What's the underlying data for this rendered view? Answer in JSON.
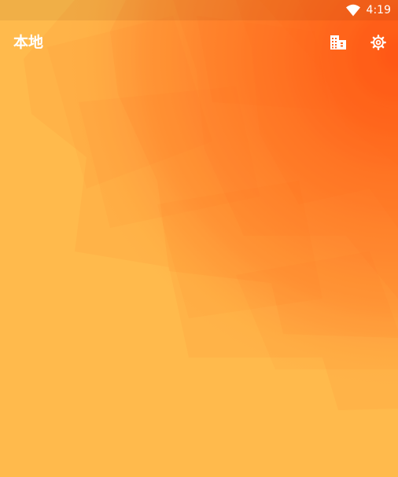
{
  "status_bar": {
    "time": "4:19",
    "wifi_icon": "wifi-icon"
  },
  "app_bar": {
    "title": "本地",
    "actions": [
      {
        "icon": "city-icon"
      },
      {
        "icon": "gear-icon"
      }
    ]
  },
  "colors": {
    "background": "#FFBA4C",
    "accent_deep": "#FF4A12",
    "accent_mid": "#FF8A30",
    "foreground": "#FFFFFF"
  }
}
